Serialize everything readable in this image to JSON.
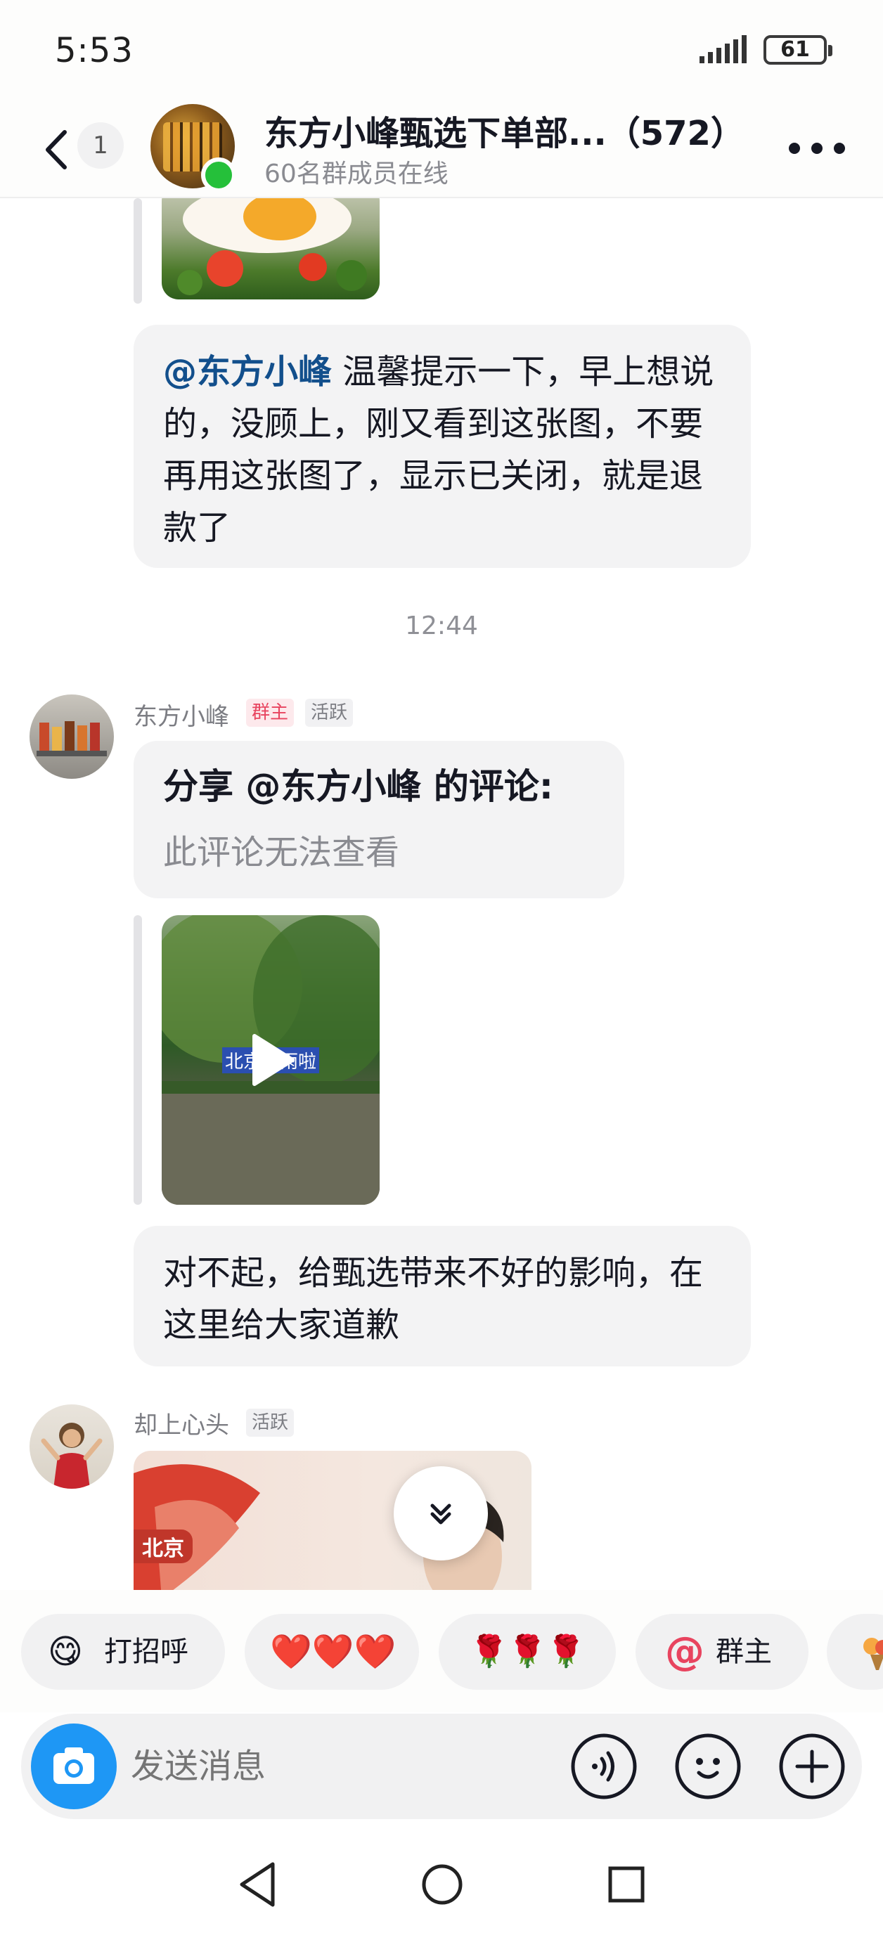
{
  "status_bar": {
    "time": "5:53",
    "battery": "61"
  },
  "header": {
    "unread_count": "1",
    "group_name": "东方小峰甄选下单部...（572）",
    "online_status": "60名群成员在线"
  },
  "messages": {
    "tip_mention": "@东方小峰",
    "tip_text": " 温馨提示一下，早上想说的，没顾上，刚又看到这张图，不要再用这张图了，显示已关闭，就是退款了",
    "time_separator": "12:44",
    "sender1": {
      "name": "东方小峰",
      "role_tag": "群主",
      "activity_tag": "活跃"
    },
    "share_title": "分享 @东方小峰 的评论:",
    "share_subtitle": "此评论无法查看",
    "video_caption": "北京下雨啦",
    "apology_text": "对不起，给甄选带来不好的影响，在这里给大家道歉",
    "sender2": {
      "name": "却上心头",
      "activity_tag": "活跃"
    },
    "image_label": "北京"
  },
  "quick_replies": [
    {
      "emoji": "😋",
      "label": "打招呼"
    },
    {
      "emoji": "",
      "label": "❤️❤️❤️"
    },
    {
      "emoji": "",
      "label": "🌹🌹🌹"
    },
    {
      "emoji": "@",
      "label": "群主"
    }
  ],
  "input": {
    "placeholder": "发送消息"
  },
  "colors": {
    "mention": "#124f8c",
    "online": "#25c03a",
    "camera": "#1e97f5",
    "owner_tag": "#e8445f"
  }
}
